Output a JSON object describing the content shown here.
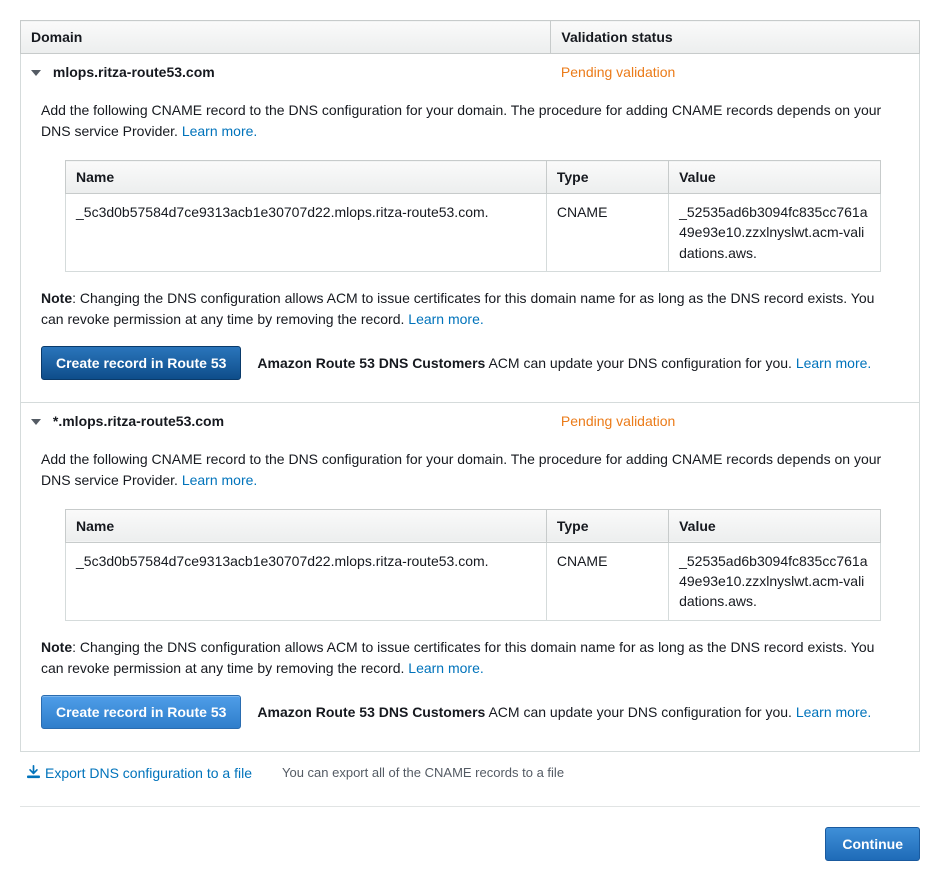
{
  "headers": {
    "domain": "Domain",
    "status": "Validation status"
  },
  "cname_headers": {
    "name": "Name",
    "type": "Type",
    "value": "Value"
  },
  "shared": {
    "instruction": "Add the following CNAME record to the DNS configuration for your domain. The procedure for adding CNAME records depends on your DNS service Provider. ",
    "learn_more": "Learn more.",
    "note_label": "Note",
    "note_text": ": Changing the DNS configuration allows ACM to issue certificates for this domain name for as long as the DNS record exists. You can revoke permission at any time by removing the record. ",
    "create_btn": "Create record in Route 53",
    "r53_customers": "Amazon Route 53 DNS Customers",
    "r53_text": " ACM can update your DNS configuration for you. "
  },
  "domains": [
    {
      "name": "mlops.ritza-route53.com",
      "status": "Pending validation",
      "cname": {
        "name": "_5c3d0b57584d7ce9313acb1e30707d22.mlops.ritza-route53.com.",
        "type": "CNAME",
        "value": "_52535ad6b3094fc835cc761a49e93e10.zzxlnyslwt.acm-validations.aws."
      }
    },
    {
      "name": "*.mlops.ritza-route53.com",
      "status": "Pending validation",
      "cname": {
        "name": "_5c3d0b57584d7ce9313acb1e30707d22.mlops.ritza-route53.com.",
        "type": "CNAME",
        "value": "_52535ad6b3094fc835cc761a49e93e10.zzxlnyslwt.acm-validations.aws."
      }
    }
  ],
  "export": {
    "link": "Export DNS configuration to a file",
    "desc": "You can export all of the CNAME records to a file"
  },
  "continue_btn": "Continue"
}
